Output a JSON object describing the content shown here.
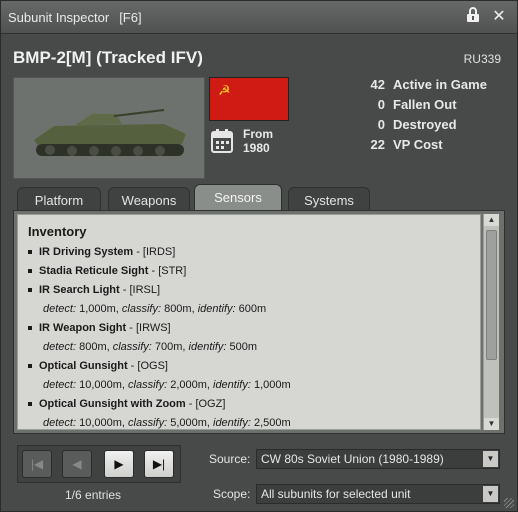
{
  "window": {
    "title": "Subunit Inspector",
    "shortcut": "[F6]"
  },
  "unit": {
    "name": "BMP-2[M] (Tracked IFV)",
    "code": "RU339",
    "from_label": "From",
    "from_year": "1980"
  },
  "stats": [
    {
      "value": "42",
      "label": "Active in Game"
    },
    {
      "value": "0",
      "label": "Fallen Out"
    },
    {
      "value": "0",
      "label": "Destroyed"
    },
    {
      "value": "22",
      "label": "VP Cost"
    }
  ],
  "tabs": [
    {
      "label": "Platform"
    },
    {
      "label": "Weapons"
    },
    {
      "label": "Sensors",
      "active": true
    },
    {
      "label": "Systems"
    }
  ],
  "inventory": {
    "title": "Inventory",
    "items": [
      {
        "name": "IR Driving System",
        "code": " - [IRDS]"
      },
      {
        "name": "Stadia Reticule Sight",
        "code": " - [STR]"
      },
      {
        "name": "IR Search Light",
        "code": " - [IRSL]",
        "detect": " 1,000m, ",
        "classify": " 800m, ",
        "identify": " 600m"
      },
      {
        "name": "IR Weapon Sight",
        "code": " - [IRWS]",
        "detect": " 800m, ",
        "classify": " 700m, ",
        "identify": " 500m"
      },
      {
        "name": "Optical Gunsight",
        "code": " - [OGS]",
        "detect": " 10,000m, ",
        "classify": " 2,000m, ",
        "identify": " 1,000m"
      },
      {
        "name": "Optical Gunsight with Zoom",
        "code": " - [OGZ]",
        "detect": " 10,000m, ",
        "classify": " 5,000m, ",
        "identify": " 2,500m"
      }
    ],
    "detect_label": "detect:",
    "classify_label": "classify:",
    "identify_label": "identify:"
  },
  "nav": {
    "entries": "1/6 entries"
  },
  "source": {
    "label": "Source:",
    "value": "CW 80s Soviet Union (1980-1989)"
  },
  "scope": {
    "label": "Scope:",
    "value": "All subunits for selected unit"
  },
  "colors": {
    "flag_red": "#d01a14",
    "flag_gold": "#f5d020"
  },
  "icons": [
    "lock-icon",
    "close-icon",
    "calendar-icon",
    "skip-first-icon",
    "prev-icon",
    "next-icon",
    "skip-last-icon",
    "dropdown-arrow-icon"
  ]
}
